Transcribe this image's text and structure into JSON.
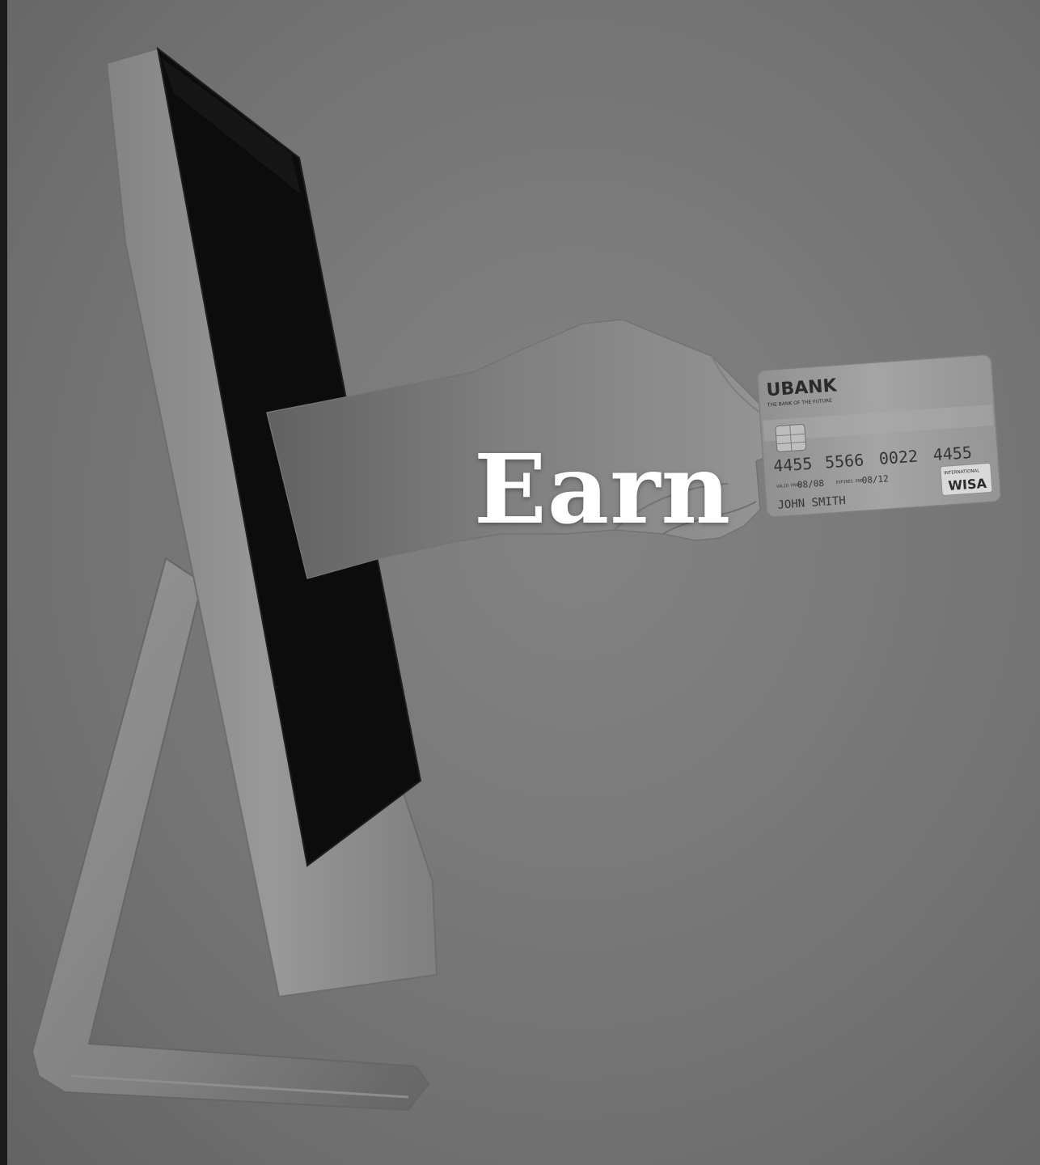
{
  "hero": {
    "title": "Earn",
    "overlay_color": "#000000"
  },
  "credit_card": {
    "bank_name": "UBANK",
    "tagline": "THE BANK OF THE FUTURE",
    "number_groups": [
      "4455",
      "5566",
      "0022",
      "4455"
    ],
    "valid_from_label": "VALID FROM",
    "valid_from": "08/08",
    "expires_label": "EXPIRES END",
    "expires": "08/12",
    "holder": "JOHN SMITH",
    "network_small": "INTERNATIONAL",
    "network": "WISA"
  },
  "icons": {
    "monitor": "monitor-icon",
    "hand": "hand-icon",
    "card": "credit-card-icon"
  }
}
